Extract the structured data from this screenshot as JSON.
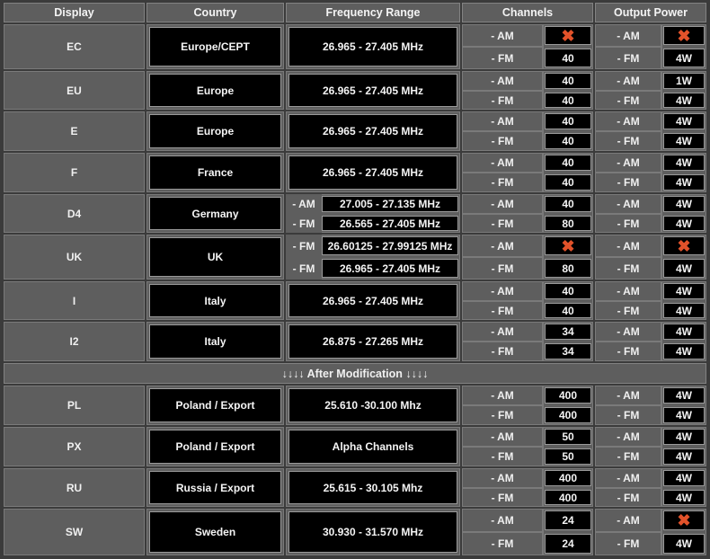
{
  "headers": {
    "display": "Display",
    "country": "Country",
    "frequency": "Frequency Range",
    "channels": "Channels",
    "power": "Output Power"
  },
  "mode_labels": {
    "am": "- AM",
    "fm": "- FM"
  },
  "separator": "↓↓↓↓ After Modification ↓↓↓↓",
  "icons": {
    "not_available": "cross-icon",
    "cross_color": "#e2522a"
  },
  "rows": [
    {
      "display": "EC",
      "country": "Europe/CEPT",
      "frequency": "26.965 - 27.405 MHz",
      "am_channels": "✖",
      "fm_channels": "40",
      "am_power": "✖",
      "fm_power": "4W"
    },
    {
      "display": "EU",
      "country": "Europe",
      "frequency": "26.965 - 27.405 MHz",
      "am_channels": "40",
      "fm_channels": "40",
      "am_power": "1W",
      "fm_power": "4W"
    },
    {
      "display": "E",
      "country": "Europe",
      "frequency": "26.965 - 27.405 MHz",
      "am_channels": "40",
      "fm_channels": "40",
      "am_power": "4W",
      "fm_power": "4W"
    },
    {
      "display": "F",
      "country": "France",
      "frequency": "26.965 - 27.405 MHz",
      "am_channels": "40",
      "fm_channels": "40",
      "am_power": "4W",
      "fm_power": "4W"
    },
    {
      "display": "D4",
      "country": "Germany",
      "frequency_am_label": "- AM",
      "frequency_am": "27.005 - 27.135 MHz",
      "frequency_fm_label": "- FM",
      "frequency_fm": "26.565 - 27.405 MHz",
      "am_channels": "40",
      "fm_channels": "80",
      "am_power": "4W",
      "fm_power": "4W"
    },
    {
      "display": "UK",
      "country": "UK",
      "frequency_am_label": "- FM",
      "frequency_am": "26.60125 - 27.99125  MHz",
      "frequency_fm_label": "- FM",
      "frequency_fm": "26.965 - 27.405 MHz",
      "am_channels": "✖",
      "fm_channels": "80",
      "am_power": "✖",
      "fm_power": "4W"
    },
    {
      "display": "I",
      "country": "Italy",
      "frequency": "26.965 - 27.405 MHz",
      "am_channels": "40",
      "fm_channels": "40",
      "am_power": "4W",
      "fm_power": "4W"
    },
    {
      "display": "I2",
      "country": "Italy",
      "frequency": "26.875 - 27.265  MHz",
      "am_channels": "34",
      "fm_channels": "34",
      "am_power": "4W",
      "fm_power": "4W"
    },
    {
      "display": "PL",
      "country": "Poland / Export",
      "frequency": "25.610 -30.100 Mhz",
      "am_channels": "400",
      "fm_channels": "400",
      "am_power": "4W",
      "fm_power": "4W"
    },
    {
      "display": "PX",
      "country": "Poland / Export",
      "frequency": "Alpha Channels",
      "am_channels": "50",
      "fm_channels": "50",
      "am_power": "4W",
      "fm_power": "4W"
    },
    {
      "display": "RU",
      "country": "Russia / Export",
      "frequency": "25.615 - 30.105 Mhz",
      "am_channels": "400",
      "fm_channels": "400",
      "am_power": "4W",
      "fm_power": "4W"
    },
    {
      "display": "SW",
      "country": "Sweden",
      "frequency": "30.930 - 31.570 MHz",
      "am_channels": "24",
      "fm_channels": "24",
      "am_power": "✖",
      "fm_power": "4W"
    }
  ]
}
